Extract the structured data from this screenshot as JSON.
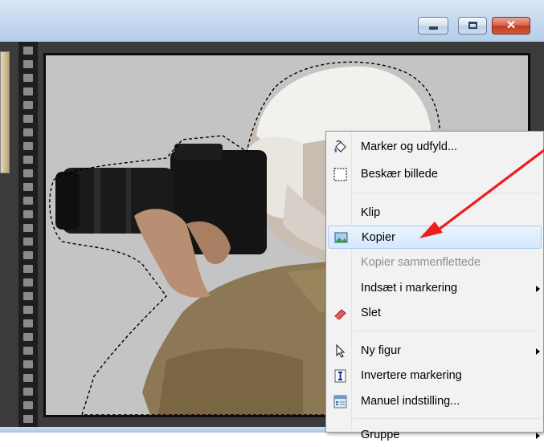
{
  "window": {
    "close_glyph": "✕"
  },
  "menu": {
    "items": [
      {
        "label": "Marker og udfyld...",
        "icon": "paint-bucket-icon",
        "enabled": true,
        "submenu": false
      },
      {
        "label": "Beskær billede",
        "icon": "crop-icon",
        "enabled": true,
        "submenu": false
      },
      {
        "label": "Klip",
        "icon": "",
        "enabled": true,
        "submenu": false
      },
      {
        "label": "Kopier",
        "icon": "copy-picture-icon",
        "enabled": true,
        "submenu": false,
        "highlighted": true
      },
      {
        "label": "Kopier sammenflettede",
        "icon": "",
        "enabled": false,
        "submenu": false
      },
      {
        "label": "Indsæt i markering",
        "icon": "",
        "enabled": true,
        "submenu": true
      },
      {
        "label": "Slet",
        "icon": "eraser-icon",
        "enabled": true,
        "submenu": false
      },
      {
        "label": "Ny figur",
        "icon": "pointer-icon",
        "enabled": true,
        "submenu": true
      },
      {
        "label": "Invertere markering",
        "icon": "invert-selection-icon",
        "enabled": true,
        "submenu": false
      },
      {
        "label": "Manuel indstilling...",
        "icon": "manual-settings-icon",
        "enabled": true,
        "submenu": false
      },
      {
        "label": "Gruppe",
        "icon": "",
        "enabled": true,
        "submenu": true
      }
    ]
  },
  "colors": {
    "annotation_arrow": "#ee1c1c",
    "menu_highlight": "#d6e8fc",
    "selection_outline": "#000000"
  }
}
